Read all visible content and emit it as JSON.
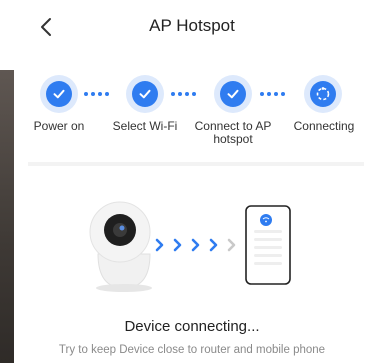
{
  "header": {
    "title": "AP Hotspot",
    "back_icon": "chevron-left-icon"
  },
  "steps": [
    {
      "label": "Power on",
      "state": "done",
      "icon": "check-icon"
    },
    {
      "label": "Select Wi-Fi",
      "state": "done",
      "icon": "check-icon"
    },
    {
      "label": "Connect to AP hotspot",
      "state": "done",
      "icon": "check-icon"
    },
    {
      "label": "Connecting",
      "state": "active",
      "icon": "loading-icon"
    }
  ],
  "status": {
    "title": "Device connecting...",
    "hint": "Try to keep Device close to router and mobile phone"
  },
  "colors": {
    "accent": "#2f7cf0",
    "accent_light": "#dde9fc",
    "text_muted": "#8a8a8a"
  }
}
